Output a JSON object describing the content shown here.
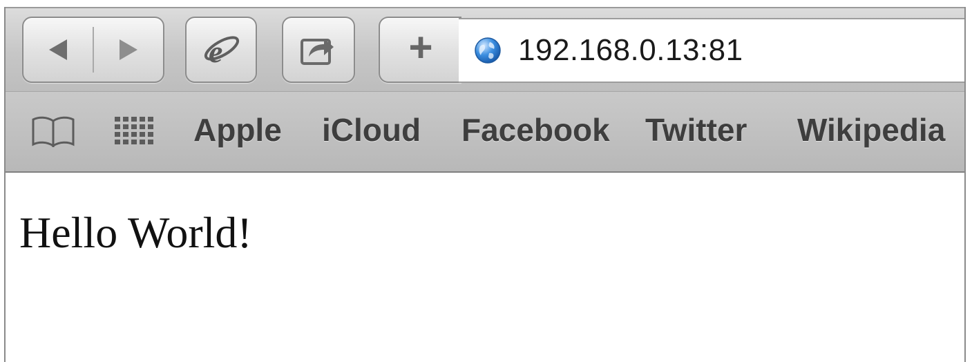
{
  "toolbar": {
    "back_icon": "back-arrow-icon",
    "forward_icon": "forward-arrow-icon",
    "ie_icon": "internet-explorer-icon",
    "share_icon": "share-icon",
    "add_label": "+",
    "address": {
      "icon": "globe-icon",
      "url": "192.168.0.13:81"
    }
  },
  "bookmarks_bar": {
    "reading_list_icon": "book-icon",
    "top_sites_icon": "grid-icon",
    "items": [
      {
        "label": "Apple"
      },
      {
        "label": "iCloud"
      },
      {
        "label": "Facebook"
      },
      {
        "label": "Twitter"
      },
      {
        "label": "Wikipedia"
      }
    ]
  },
  "page": {
    "text": "Hello World!"
  },
  "colors": {
    "toolbar": "#c6c6c6",
    "bookmark_text": "#3e3e3e",
    "globe": "#2f7fd6"
  }
}
